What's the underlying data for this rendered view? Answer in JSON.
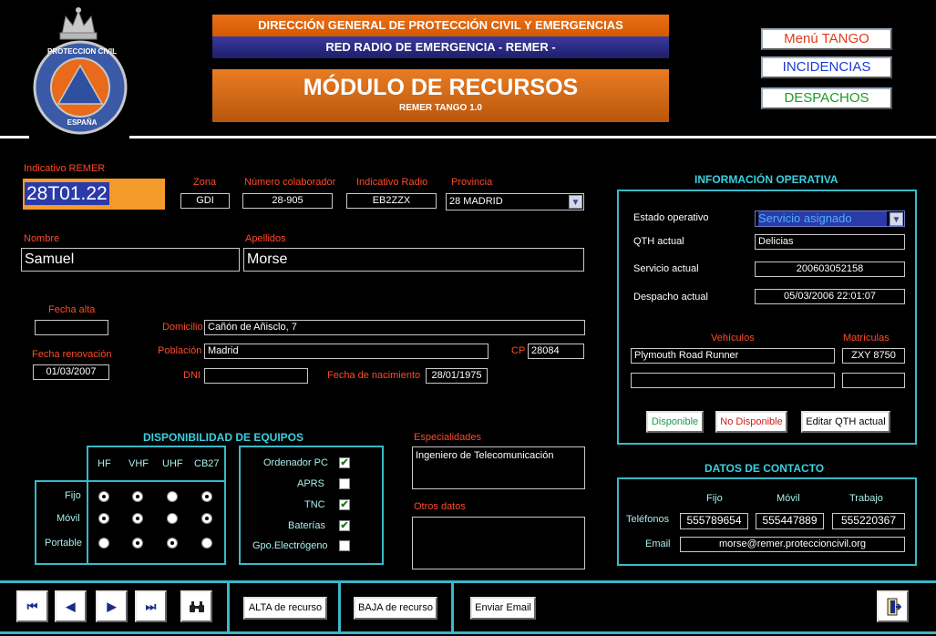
{
  "header": {
    "org_line": "DIRECCIÓN GENERAL DE PROTECCIÓN CIVIL Y EMERGENCIAS",
    "network_line": "RED RADIO DE EMERGENCIA - REMER -",
    "module_title": "MÓDULO DE RECURSOS",
    "module_subtitle": "REMER TANGO 1.0",
    "logo_text_top": "PROTECCION CIVIL",
    "logo_text_bottom": "ESPAÑA"
  },
  "top_buttons": {
    "menu": "Menú TANGO",
    "incidencias": "INCIDENCIAS",
    "despachos": "DESPACHOS"
  },
  "identity": {
    "indicativo_label": "Indicativo REMER",
    "indicativo_value": "28T01.22",
    "zona_label": "Zona",
    "zona_value": "GDI",
    "numero_label": "Número colaborador",
    "numero_value": "28-905",
    "radio_label": "Indicativo Radio",
    "radio_value": "EB2ZZX",
    "provincia_label": "Provincia",
    "provincia_value": "28 MADRID",
    "nombre_label": "Nombre",
    "nombre_value": "Samuel",
    "apellidos_label": "Apellidos",
    "apellidos_value": "Morse"
  },
  "address": {
    "fecha_alta_label": "Fecha alta",
    "fecha_alta_value": "",
    "fecha_renov_label": "Fecha renovación",
    "fecha_renov_value": "01/03/2007",
    "domicilio_label": "Domicilio",
    "domicilio_value": "Cañón de Añisclo, 7",
    "poblacion_label": "Población",
    "poblacion_value": "Madrid",
    "cp_label": "CP",
    "cp_value": "28084",
    "dni_label": "DNI",
    "dni_value": "",
    "nacimiento_label": "Fecha de nacimiento",
    "nacimiento_value": "28/01/1975"
  },
  "operativa": {
    "title": "INFORMACIÓN OPERATIVA",
    "estado_label": "Estado operativo",
    "estado_value": "Servicio asignado",
    "qth_label": "QTH actual",
    "qth_value": "Delicias",
    "servicio_label": "Servicio actual",
    "servicio_value": "200603052158",
    "despacho_label": "Despacho actual",
    "despacho_value": "05/03/2006 22:01:07",
    "vehiculos_label": "Vehículos",
    "matriculas_label": "Matrículas",
    "vehiculo1": "Plymouth Road Runner",
    "matricula1": "ZXY 8750",
    "vehiculo2": "",
    "matricula2": "",
    "btn_disponible": "Disponible",
    "btn_no_disponible": "No Disponible",
    "btn_editar_qth": "Editar QTH actual"
  },
  "equipos": {
    "title": "DISPONIBILIDAD DE EQUIPOS",
    "columns": [
      "HF",
      "VHF",
      "UHF",
      "CB27"
    ],
    "rows": [
      {
        "label": "Fijo",
        "values": [
          true,
          true,
          false,
          true
        ]
      },
      {
        "label": "Móvil",
        "values": [
          true,
          true,
          false,
          true
        ]
      },
      {
        "label": "Portable",
        "values": [
          false,
          true,
          true,
          false
        ]
      }
    ],
    "checks": [
      {
        "label": "Ordenador PC",
        "checked": true
      },
      {
        "label": "APRS",
        "checked": false
      },
      {
        "label": "TNC",
        "checked": true
      },
      {
        "label": "Baterías",
        "checked": true
      },
      {
        "label": "Gpo.Electrógeno",
        "checked": false
      }
    ]
  },
  "notes": {
    "especialidades_label": "Especialidades",
    "especialidades_value": "Ingeniero de Telecomunicación",
    "otros_label": "Otros datos",
    "otros_value": ""
  },
  "contacto": {
    "title": "DATOS DE CONTACTO",
    "fijo_label": "Fijo",
    "movil_label": "Móvil",
    "trabajo_label": "Trabajo",
    "telefonos_label": "Teléfonos",
    "tel_fijo": "555789654",
    "tel_movil": "555447889",
    "tel_trabajo": "555220367",
    "email_label": "Email",
    "email_value": "morse@remer.proteccioncivil.org"
  },
  "footer": {
    "btn_first": "⏮",
    "btn_prev": "◀",
    "btn_next": "▶",
    "btn_last": "⏭",
    "btn_alta": "ALTA de recurso",
    "btn_baja": "BAJA de recurso",
    "btn_email": "Enviar Email"
  },
  "colors": {
    "accent_cyan": "#3bb8c8",
    "label_red": "#ff4a2a",
    "orange": "#e8701a",
    "navy": "#1e1e6a"
  }
}
